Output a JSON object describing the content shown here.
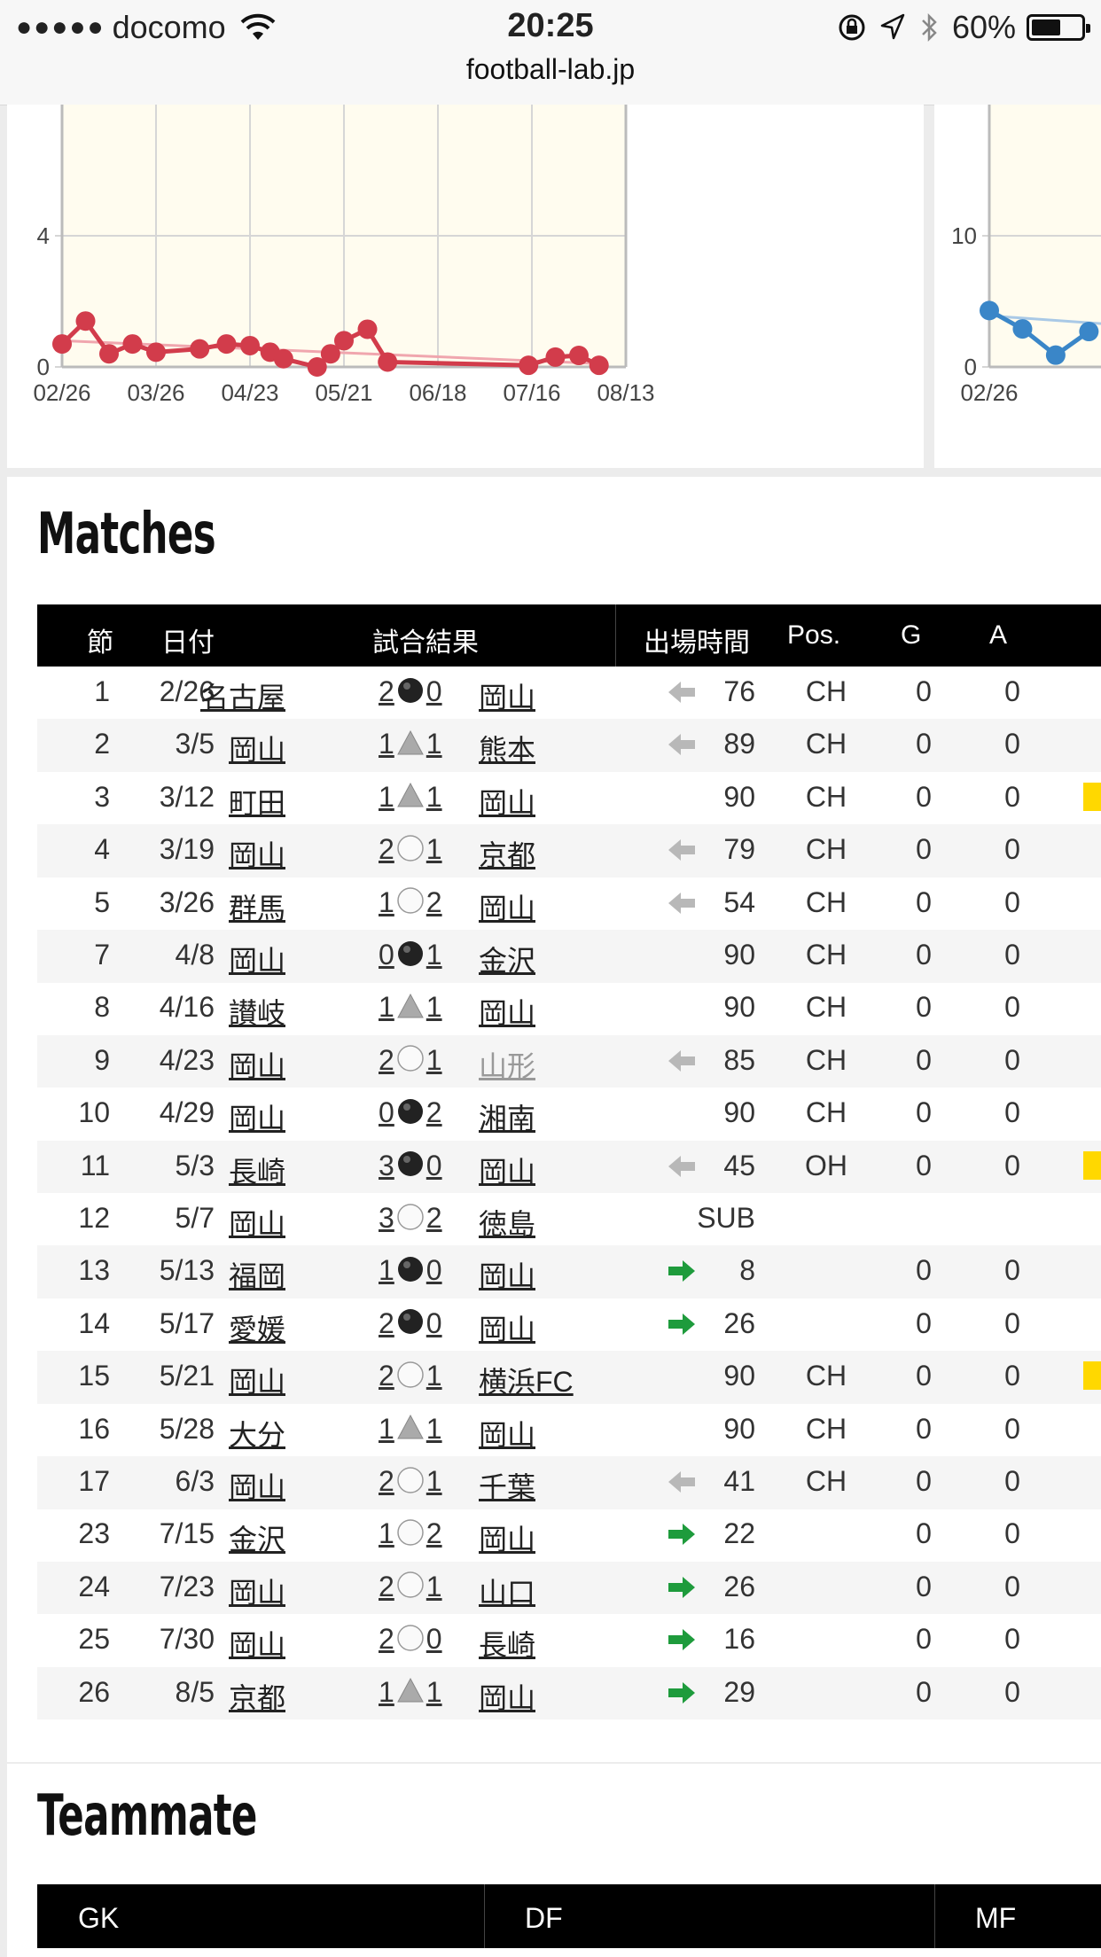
{
  "status_bar": {
    "signal_dots": "●●●●●",
    "carrier": "docomo",
    "time": "20:25",
    "battery": "60%",
    "battery_level": 0.6
  },
  "browser": {
    "url": "football-lab.jp"
  },
  "chart_data": [
    {
      "type": "line",
      "x_ticks": [
        "02/26",
        "03/26",
        "04/23",
        "05/21",
        "06/18",
        "07/16",
        "08/13"
      ],
      "y_ticks": [
        "0",
        "4"
      ],
      "ylim": [
        0,
        6
      ],
      "series": [
        {
          "points": [
            [
              "02/26",
              0.7
            ],
            [
              "03/05",
              1.4
            ],
            [
              "03/12",
              0.4
            ],
            [
              "03/19",
              0.7
            ],
            [
              "03/26",
              0.45
            ],
            [
              "04/08",
              0.55
            ],
            [
              "04/16",
              0.7
            ],
            [
              "04/23",
              0.65
            ],
            [
              "04/29",
              0.45
            ],
            [
              "05/03",
              0.25
            ],
            [
              "05/13",
              0.0
            ],
            [
              "05/17",
              0.4
            ],
            [
              "05/21",
              0.8
            ],
            [
              "05/28",
              1.15
            ],
            [
              "06/03",
              0.15
            ],
            [
              "07/15",
              0.05
            ],
            [
              "07/23",
              0.3
            ],
            [
              "07/30",
              0.35
            ],
            [
              "08/05",
              0.05
            ]
          ],
          "trend": [
            0.8,
            0.1
          ],
          "color": "#d23c4b"
        }
      ],
      "grid": true
    },
    {
      "type": "line",
      "x_ticks": [
        "02/26"
      ],
      "y_ticks": [
        "0",
        "10"
      ],
      "series": [
        {
          "points": [
            [
              "02/26",
              4.3
            ],
            [
              "03/05",
              2.9
            ],
            [
              "03/12",
              0.9
            ],
            [
              "03/19",
              2.7
            ]
          ],
          "color": "#3a86c8"
        }
      ],
      "grid": true
    }
  ],
  "matches": {
    "title": "Matches",
    "headers": {
      "round": "節",
      "date": "日付",
      "result": "試合結果",
      "minutes": "出場時間",
      "pos": "Pos.",
      "g": "G",
      "a": "A"
    },
    "rows": [
      {
        "n": "1",
        "d": "2/26",
        "h": "名古屋",
        "hs": "2",
        "r": "black",
        "as": "0",
        "a": "岡山",
        "arr": "gray",
        "m": "76",
        "p": "CH",
        "g": "0",
        "aa": "0",
        "card": false
      },
      {
        "n": "2",
        "d": "3/5",
        "h": "岡山",
        "hs": "1",
        "r": "tri",
        "as": "1",
        "a": "熊本",
        "arr": "gray",
        "m": "89",
        "p": "CH",
        "g": "0",
        "aa": "0",
        "card": false
      },
      {
        "n": "3",
        "d": "3/12",
        "h": "町田",
        "hs": "1",
        "r": "tri",
        "as": "1",
        "a": "岡山",
        "arr": "",
        "m": "90",
        "p": "CH",
        "g": "0",
        "aa": "0",
        "card": true
      },
      {
        "n": "4",
        "d": "3/19",
        "h": "岡山",
        "hs": "2",
        "r": "white",
        "as": "1",
        "a": "京都",
        "arr": "gray",
        "m": "79",
        "p": "CH",
        "g": "0",
        "aa": "0",
        "card": false
      },
      {
        "n": "5",
        "d": "3/26",
        "h": "群馬",
        "hs": "1",
        "r": "white",
        "as": "2",
        "a": "岡山",
        "arr": "gray",
        "m": "54",
        "p": "CH",
        "g": "0",
        "aa": "0",
        "card": false
      },
      {
        "n": "7",
        "d": "4/8",
        "h": "岡山",
        "hs": "0",
        "r": "black",
        "as": "1",
        "a": "金沢",
        "arr": "",
        "m": "90",
        "p": "CH",
        "g": "0",
        "aa": "0",
        "card": false
      },
      {
        "n": "8",
        "d": "4/16",
        "h": "讃岐",
        "hs": "1",
        "r": "tri",
        "as": "1",
        "a": "岡山",
        "arr": "",
        "m": "90",
        "p": "CH",
        "g": "0",
        "aa": "0",
        "card": false
      },
      {
        "n": "9",
        "d": "4/23",
        "h": "岡山",
        "hs": "2",
        "r": "white",
        "as": "1",
        "a": "山形",
        "muted": true,
        "arr": "gray",
        "m": "85",
        "p": "CH",
        "g": "0",
        "aa": "0",
        "card": false
      },
      {
        "n": "10",
        "d": "4/29",
        "h": "岡山",
        "hs": "0",
        "r": "black",
        "as": "2",
        "a": "湘南",
        "arr": "",
        "m": "90",
        "p": "CH",
        "g": "0",
        "aa": "0",
        "card": false
      },
      {
        "n": "11",
        "d": "5/3",
        "h": "長崎",
        "hs": "3",
        "r": "black",
        "as": "0",
        "a": "岡山",
        "arr": "gray",
        "m": "45",
        "p": "OH",
        "g": "0",
        "aa": "0",
        "card": true
      },
      {
        "n": "12",
        "d": "5/7",
        "h": "岡山",
        "hs": "3",
        "r": "white",
        "as": "2",
        "a": "徳島",
        "arr": "",
        "m": "SUB",
        "p": "",
        "g": "",
        "aa": "",
        "card": false
      },
      {
        "n": "13",
        "d": "5/13",
        "h": "福岡",
        "hs": "1",
        "r": "black",
        "as": "0",
        "a": "岡山",
        "arr": "green",
        "m": "8",
        "p": "",
        "g": "0",
        "aa": "0",
        "card": false
      },
      {
        "n": "14",
        "d": "5/17",
        "h": "愛媛",
        "hs": "2",
        "r": "black",
        "as": "0",
        "a": "岡山",
        "arr": "green",
        "m": "26",
        "p": "",
        "g": "0",
        "aa": "0",
        "card": false
      },
      {
        "n": "15",
        "d": "5/21",
        "h": "岡山",
        "hs": "2",
        "r": "white",
        "as": "1",
        "a": "横浜FC",
        "arr": "",
        "m": "90",
        "p": "CH",
        "g": "0",
        "aa": "0",
        "card": true
      },
      {
        "n": "16",
        "d": "5/28",
        "h": "大分",
        "hs": "1",
        "r": "tri",
        "as": "1",
        "a": "岡山",
        "arr": "",
        "m": "90",
        "p": "CH",
        "g": "0",
        "aa": "0",
        "card": false
      },
      {
        "n": "17",
        "d": "6/3",
        "h": "岡山",
        "hs": "2",
        "r": "white",
        "as": "1",
        "a": "千葉",
        "arr": "gray",
        "m": "41",
        "p": "CH",
        "g": "0",
        "aa": "0",
        "card": false
      },
      {
        "n": "23",
        "d": "7/15",
        "h": "金沢",
        "hs": "1",
        "r": "white",
        "as": "2",
        "a": "岡山",
        "arr": "green",
        "m": "22",
        "p": "",
        "g": "0",
        "aa": "0",
        "card": false
      },
      {
        "n": "24",
        "d": "7/23",
        "h": "岡山",
        "hs": "2",
        "r": "white",
        "as": "1",
        "a": "山口",
        "arr": "green",
        "m": "26",
        "p": "",
        "g": "0",
        "aa": "0",
        "card": false
      },
      {
        "n": "25",
        "d": "7/30",
        "h": "岡山",
        "hs": "2",
        "r": "white",
        "as": "0",
        "a": "長崎",
        "arr": "green",
        "m": "16",
        "p": "",
        "g": "0",
        "aa": "0",
        "card": false
      },
      {
        "n": "26",
        "d": "8/5",
        "h": "京都",
        "hs": "1",
        "r": "tri",
        "as": "1",
        "a": "岡山",
        "arr": "green",
        "m": "29",
        "p": "",
        "g": "0",
        "aa": "0",
        "card": false
      }
    ]
  },
  "teammate": {
    "title": "Teammate",
    "headers": [
      "GK",
      "DF",
      "MF"
    ]
  }
}
